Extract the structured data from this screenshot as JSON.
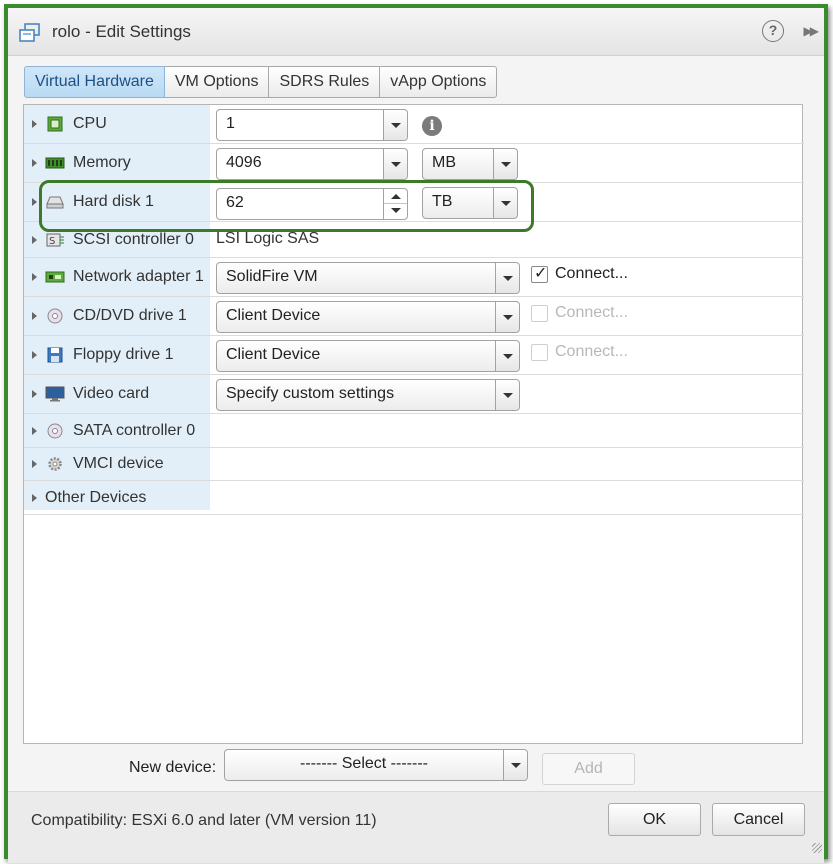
{
  "window": {
    "title": "rolo - Edit Settings",
    "help_glyph": "?",
    "expand_glyph": "▶▶"
  },
  "tabs": [
    {
      "label": "Virtual Hardware",
      "active": true
    },
    {
      "label": "VM Options",
      "active": false
    },
    {
      "label": "SDRS Rules",
      "active": false
    },
    {
      "label": "vApp Options",
      "active": false
    }
  ],
  "hardware": {
    "cpu": {
      "label": "CPU",
      "value": "1",
      "info_glyph": "i"
    },
    "memory": {
      "label": "Memory",
      "value": "4096",
      "unit": "MB"
    },
    "hard_disk": {
      "label": "Hard disk 1",
      "value": "62",
      "unit": "TB"
    },
    "scsi": {
      "label": "SCSI controller 0",
      "value": "LSI Logic SAS"
    },
    "network": {
      "label": "Network adapter 1",
      "value": "SolidFire VM",
      "connect_label": "Connect...",
      "connected": true
    },
    "cddvd": {
      "label": "CD/DVD drive 1",
      "value": "Client Device",
      "connect_label": "Connect...",
      "connected": false
    },
    "floppy": {
      "label": "Floppy drive 1",
      "value": "Client Device",
      "connect_label": "Connect...",
      "connected": false
    },
    "video": {
      "label": "Video card",
      "value": "Specify custom settings"
    },
    "sata": {
      "label": "SATA controller 0"
    },
    "vmci": {
      "label": "VMCI device"
    },
    "other": {
      "label": "Other Devices"
    }
  },
  "new_device": {
    "label": "New device:",
    "select_value": "------- Select -------",
    "add_label": "Add"
  },
  "footer": {
    "compatibility": "Compatibility: ESXi 6.0 and later (VM version 11)",
    "ok_label": "OK",
    "cancel_label": "Cancel"
  },
  "colors": {
    "highlight_border": "#3c7a2a",
    "frame_border": "#3c8a2e",
    "active_tab": "#b9daf3",
    "label_column": "#e3eff8"
  }
}
